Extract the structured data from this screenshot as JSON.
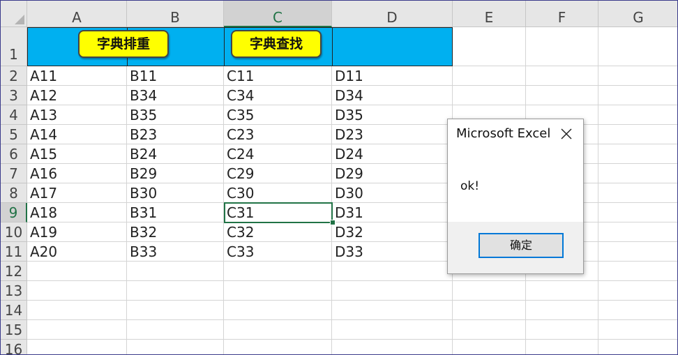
{
  "columns": [
    "A",
    "B",
    "C",
    "D",
    "E",
    "F",
    "G"
  ],
  "selected_column": "C",
  "rows": [
    "1",
    "2",
    "3",
    "4",
    "5",
    "6",
    "7",
    "8",
    "9",
    "10",
    "11",
    "12",
    "13",
    "14",
    "15",
    "16"
  ],
  "selected_row": "9",
  "buttons": {
    "sort_label": "字典排重",
    "lookup_label": "字典查找"
  },
  "data": [
    [
      "A11",
      "B11",
      "C11",
      "D11"
    ],
    [
      "A12",
      "B34",
      "C34",
      "D34"
    ],
    [
      "A13",
      "B35",
      "C35",
      "D35"
    ],
    [
      "A14",
      "B23",
      "C23",
      "D23"
    ],
    [
      "A15",
      "B24",
      "C24",
      "D24"
    ],
    [
      "A16",
      "B29",
      "C29",
      "D29"
    ],
    [
      "A17",
      "B30",
      "C30",
      "D30"
    ],
    [
      "A18",
      "B31",
      "C31",
      "D31"
    ],
    [
      "A19",
      "B32",
      "C32",
      "D32"
    ],
    [
      "A20",
      "B33",
      "C33",
      "D33"
    ]
  ],
  "dialog": {
    "title": "Microsoft Excel",
    "message": "ok!",
    "ok_label": "确定"
  },
  "colors": {
    "header_fill": "#00b0f0",
    "button_fill": "#ffff00",
    "selection": "#217346",
    "dialog_accent": "#0078d7"
  }
}
